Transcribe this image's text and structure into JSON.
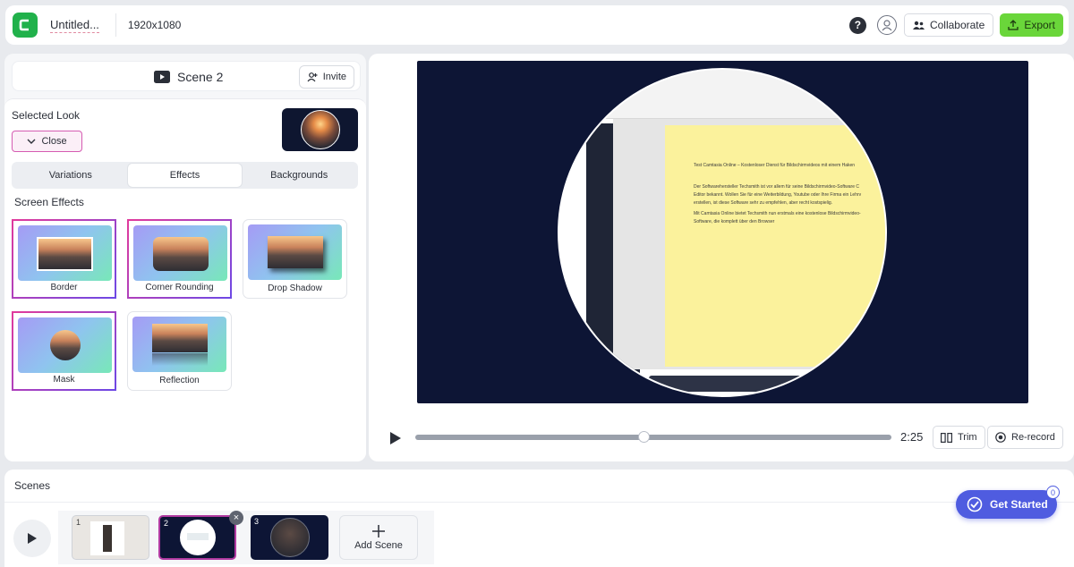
{
  "topbar": {
    "project_title": "Untitled...",
    "resolution": "1920x1080",
    "help_label": "?",
    "collaborate_label": "Collaborate",
    "export_label": "Export"
  },
  "scene_header": {
    "title": "Scene 2",
    "invite_label": "Invite"
  },
  "look": {
    "heading": "Selected Look",
    "close_label": "Close"
  },
  "tabs": [
    {
      "label": "Variations",
      "active": false
    },
    {
      "label": "Effects",
      "active": true
    },
    {
      "label": "Backgrounds",
      "active": false
    }
  ],
  "effects": {
    "heading": "Screen Effects",
    "items": [
      {
        "label": "Border",
        "selected": true
      },
      {
        "label": "Corner Rounding",
        "selected": true
      },
      {
        "label": "Drop Shadow",
        "selected": false
      },
      {
        "label": "Mask",
        "selected": true
      },
      {
        "label": "Reflection",
        "selected": false
      }
    ]
  },
  "preview": {
    "doc_lines": [
      "Test Camtasia Online – Kostenloser Dienst für Bildschirmvideos mit einem Haken",
      "Der Softwarehersteller Techsmith ist vor allem für seine Bildschirmvideo-Software C",
      "Editor bekannt. Wollen Sie für eine Weiterbildung, Youtube oder Ihre Firma ein Lehrv",
      "erstellen, ist diese Software sehr zu empfehlen, aber recht kostspielig.",
      "Mit Camtasia Online bietet Techsmith nun erstmals eine kostenlose Bildschirmvideo-",
      "Software, die komplett über den Browser"
    ]
  },
  "player": {
    "progress": 0.48,
    "duration": "2:25",
    "trim_label": "Trim",
    "rerecord_label": "Re-record"
  },
  "scenes": {
    "heading": "Scenes",
    "thumbs": [
      "1",
      "2",
      "3"
    ],
    "remove_glyph": "×",
    "add_label": "Add Scene"
  },
  "get_started": {
    "label": "Get Started",
    "badge": "0"
  },
  "colors": {
    "accent_green": "#6ad63a",
    "brand_green": "#21b14b",
    "selection_gradient": [
      "#e13a9c",
      "#6d48e5"
    ],
    "get_started_blue": "#4f5ce0"
  }
}
